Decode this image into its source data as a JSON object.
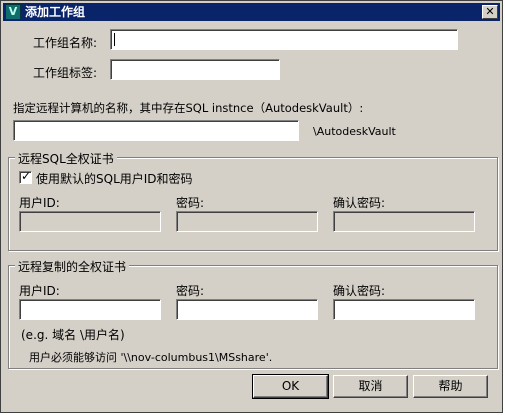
{
  "window": {
    "title": "添加工作组",
    "close_symbol": "✕"
  },
  "fields": {
    "workgroup_name_label": "工作组名称:",
    "workgroup_name_value": "",
    "workgroup_tag_label": "工作组标签:",
    "workgroup_tag_value": ""
  },
  "remote": {
    "prompt": "指定远程计算机的名称，其中存在SQL instnce（AutodeskVault）:",
    "computer_value": "",
    "suffix": "\\AutodeskVault"
  },
  "sql_group": {
    "title": "远程SQL全权证书",
    "checkbox_label": "使用默认的SQL用户ID和密码",
    "checked": true,
    "user_id_label": "用户ID:",
    "password_label": "密码:",
    "confirm_label": "确认密码:"
  },
  "copy_group": {
    "title": "远程复制的全权证书",
    "user_id_label": "用户ID:",
    "password_label": "密码:",
    "confirm_label": "确认密码:",
    "hint": "(e.g. 域名 \\用户名)",
    "note": "用户必须能够访问 '\\\\nov-columbus1\\MSshare'."
  },
  "buttons": {
    "ok": "OK",
    "cancel": "取消",
    "help": "帮助"
  }
}
